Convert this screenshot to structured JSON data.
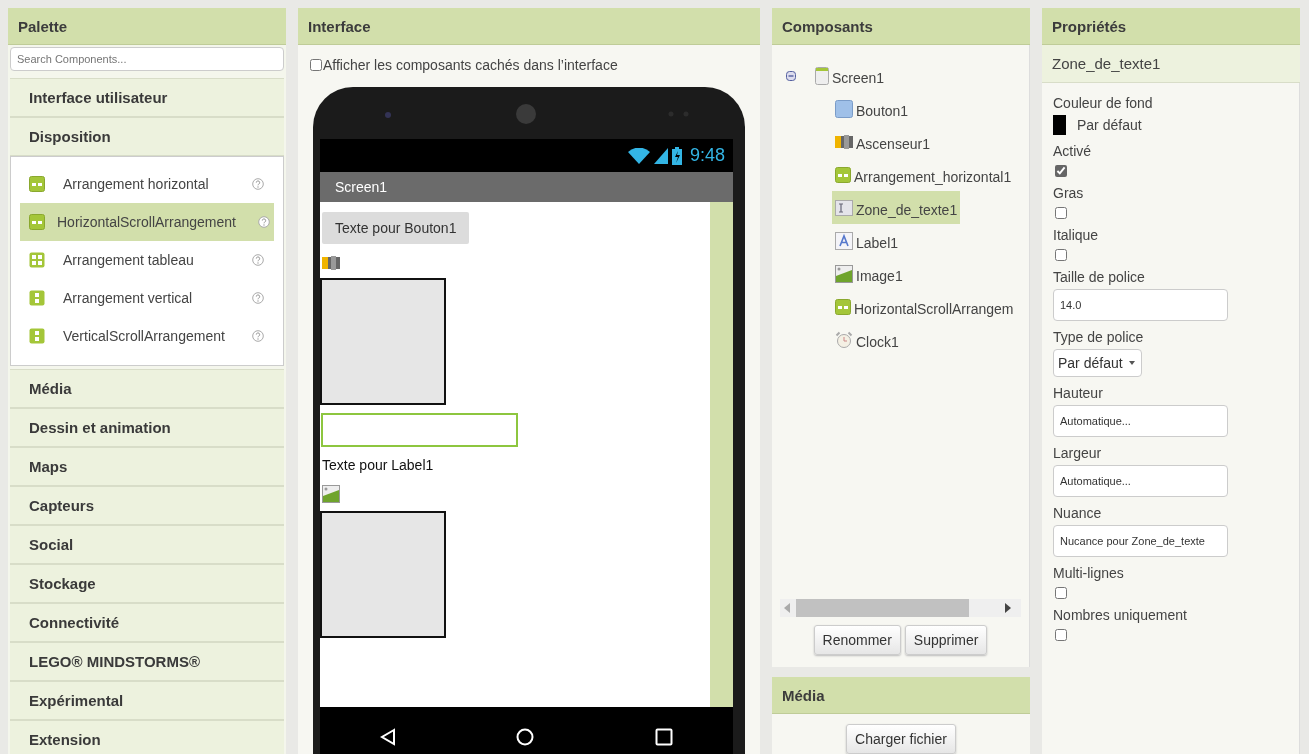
{
  "palette": {
    "title": "Palette",
    "search": {
      "placeholder": "Search Components..."
    },
    "categories": [
      {
        "label": "Interface utilisateur"
      },
      {
        "label": "Disposition",
        "items": [
          {
            "label": "Arrangement horizontal",
            "kind": "horizontal",
            "selected": false
          },
          {
            "label": "HorizontalScrollArrangement",
            "kind": "horizontal",
            "selected": true
          },
          {
            "label": "Arrangement tableau",
            "kind": "table",
            "selected": false
          },
          {
            "label": "Arrangement vertical",
            "kind": "vertical",
            "selected": false
          },
          {
            "label": "VerticalScrollArrangement",
            "kind": "vertical",
            "selected": false
          }
        ]
      },
      {
        "label": "Média"
      },
      {
        "label": "Dessin et animation"
      },
      {
        "label": "Maps"
      },
      {
        "label": "Capteurs"
      },
      {
        "label": "Social"
      },
      {
        "label": "Stockage"
      },
      {
        "label": "Connectivité"
      },
      {
        "label": "LEGO® MINDSTORMS®"
      },
      {
        "label": "Expérimental"
      },
      {
        "label": "Extension"
      }
    ]
  },
  "interface": {
    "title": "Interface",
    "show_hidden": {
      "label": "Afficher les composants cachés dans l’interface",
      "checked": false
    },
    "phone": {
      "time": "9:48",
      "screen_title": "Screen1",
      "items": [
        {
          "kind": "button",
          "text": "Texte pour Bouton1"
        },
        {
          "kind": "slider"
        },
        {
          "kind": "arrangement"
        },
        {
          "kind": "textbox",
          "selected": true
        },
        {
          "kind": "label",
          "text": "Texte pour Label1"
        },
        {
          "kind": "image"
        },
        {
          "kind": "arrangement"
        }
      ]
    }
  },
  "components": {
    "title": "Composants",
    "tree": {
      "label": "Screen1",
      "kind": "screen",
      "expanded": true,
      "selected": false,
      "children": [
        {
          "label": "Bouton1",
          "kind": "button",
          "selected": false
        },
        {
          "label": "Ascenseur1",
          "kind": "slider",
          "selected": false
        },
        {
          "label": "Arrangement_horizontal1",
          "kind": "horizontal",
          "selected": false
        },
        {
          "label": "Zone_de_texte1",
          "kind": "textbox",
          "selected": true
        },
        {
          "label": "Label1",
          "kind": "label",
          "selected": false
        },
        {
          "label": "Image1",
          "kind": "image",
          "selected": false
        },
        {
          "label": "HorizontalScrollArrangem",
          "kind": "horizontal",
          "selected": false
        },
        {
          "label": "Clock1",
          "kind": "clock",
          "selected": false
        }
      ]
    },
    "buttons": [
      "Renommer",
      "Supprimer"
    ]
  },
  "media": {
    "title": "Média",
    "button": "Charger fichier"
  },
  "properties": {
    "title": "Propriétés",
    "component": "Zone_de_texte1",
    "items": [
      {
        "kind": "color",
        "label": "Couleur de fond",
        "value": "Par défaut",
        "color": "#000000"
      },
      {
        "kind": "checkbox",
        "label": "Activé",
        "checked": true
      },
      {
        "kind": "checkbox",
        "label": "Gras",
        "checked": false
      },
      {
        "kind": "checkbox",
        "label": "Italique",
        "checked": false
      },
      {
        "kind": "text",
        "label": "Taille de police",
        "value": "14.0"
      },
      {
        "kind": "dropdown",
        "label": "Type de police",
        "value": "Par défaut"
      },
      {
        "kind": "text",
        "label": "Hauteur",
        "value": "Automatique..."
      },
      {
        "kind": "text",
        "label": "Largeur",
        "value": "Automatique..."
      },
      {
        "kind": "text",
        "label": "Nuance",
        "value": "Nucance pour Zone_de_texte"
      },
      {
        "kind": "checkbox",
        "label": "Multi-lignes",
        "checked": false
      },
      {
        "kind": "checkbox",
        "label": "Nombres uniquement",
        "checked": false
      }
    ]
  }
}
